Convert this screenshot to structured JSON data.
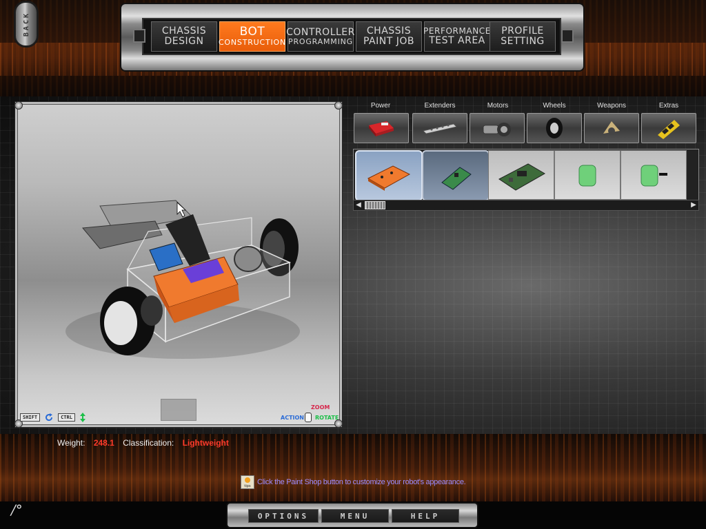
{
  "back_button": {
    "label": "BACK"
  },
  "nav": {
    "tabs": [
      {
        "line1": "CHASSIS",
        "line2": "DESIGN",
        "active": false
      },
      {
        "line1": "BOT",
        "line2": "CONSTRUCTION",
        "active": true
      },
      {
        "line1": "CONTROLLER",
        "line2": "PROGRAMMING",
        "active": false
      },
      {
        "line1": "CHASSIS",
        "line2": "PAINT JOB",
        "active": false
      },
      {
        "line1": "PERFORMANCE",
        "line2": "TEST AREA",
        "active": false
      },
      {
        "line1": "PROFILE",
        "line2": "SETTING",
        "active": false
      }
    ]
  },
  "viewport": {
    "keys": {
      "shift": "SHIFT",
      "ctrl": "CTRL"
    },
    "mouse_legend": {
      "action": "ACTION",
      "zoom": "ZOOM",
      "rotate": "ROTATE"
    }
  },
  "categories": [
    {
      "label": "Power",
      "icon": "battery-icon"
    },
    {
      "label": "Extenders",
      "icon": "extender-bar-icon"
    },
    {
      "label": "Motors",
      "icon": "motor-icon"
    },
    {
      "label": "Wheels",
      "icon": "wheel-icon"
    },
    {
      "label": "Weapons",
      "icon": "weapon-blade-icon"
    },
    {
      "label": "Extras",
      "icon": "extras-hazard-icon"
    }
  ],
  "parts": [
    {
      "icon": "orange-controller-board-icon",
      "state": "selected"
    },
    {
      "icon": "green-circuit-board-icon",
      "state": "hover"
    },
    {
      "icon": "large-circuit-board-icon",
      "state": "normal"
    },
    {
      "icon": "green-receiver-icon",
      "state": "normal"
    },
    {
      "icon": "green-receiver-antenna-icon",
      "state": "normal"
    }
  ],
  "stats": {
    "weight_label": "Weight:",
    "weight_value": "248.1",
    "class_label": "Classification:",
    "class_value": "Lightweight"
  },
  "tip": {
    "icon_label": "tips",
    "text": "Click the Paint Shop button to customize your robot's appearance."
  },
  "bottom_menu": {
    "options": "OPTIONS",
    "menu": "MENU",
    "help": "HELP"
  },
  "logo": {
    "text": "/°"
  },
  "colors": {
    "accent_orange": "#f26b12",
    "stat_value_red": "#ff3a2a",
    "tip_text": "#9d8cff"
  }
}
